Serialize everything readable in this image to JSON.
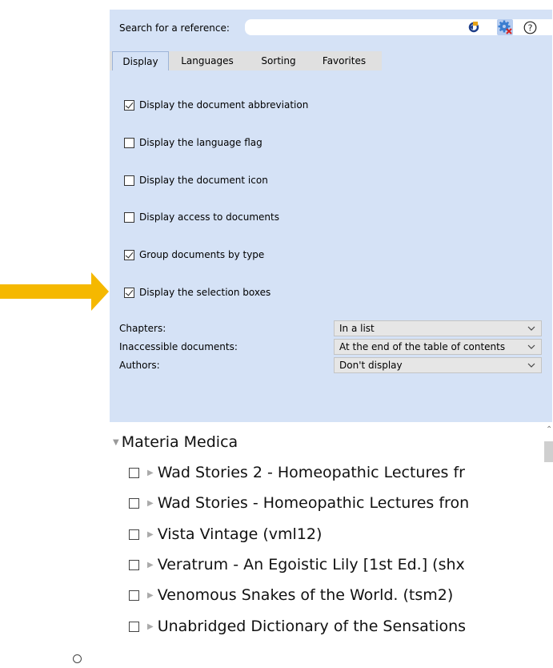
{
  "search": {
    "label": "Search for a reference:",
    "value": "",
    "placeholder": ""
  },
  "toolbar": {
    "refresh_icon": "refresh-icon",
    "settings_icon": "gear-close-icon",
    "help_icon": "help-icon",
    "help_glyph": "?"
  },
  "tabs": [
    {
      "label": "Display",
      "active": true
    },
    {
      "label": "Languages",
      "active": false
    },
    {
      "label": "Sorting",
      "active": false
    },
    {
      "label": "Favorites",
      "active": false
    }
  ],
  "display_options": [
    {
      "label": "Display the document abbreviation",
      "checked": true
    },
    {
      "label": "Display the language flag",
      "checked": false
    },
    {
      "label": "Display the document icon",
      "checked": false
    },
    {
      "label": "Display access to documents",
      "checked": false
    },
    {
      "label": "Group documents by type",
      "checked": true
    },
    {
      "label": "Display the selection boxes",
      "checked": true
    }
  ],
  "selects": [
    {
      "label": "Chapters:",
      "value": "In a list"
    },
    {
      "label": "Inaccessible documents:",
      "value": "At the end of the table of contents"
    },
    {
      "label": "Authors:",
      "value": "Don't display"
    }
  ],
  "tree": {
    "root": "Materia Medica",
    "items": [
      "Wad Stories 2 - Homeopathic Lectures fr",
      "Wad Stories - Homeopathic Lectures fron",
      "Vista Vintage (vml12)",
      "Veratrum - An Egoistic Lily [1st Ed.] (shx",
      "Venomous Snakes of the World. (tsm2)",
      "Unabridged Dictionary of the Sensations"
    ]
  },
  "colors": {
    "panel_bg": "#d5e2f6",
    "arrow": "#f5b800",
    "tab_strip": "#e0e0e0"
  }
}
